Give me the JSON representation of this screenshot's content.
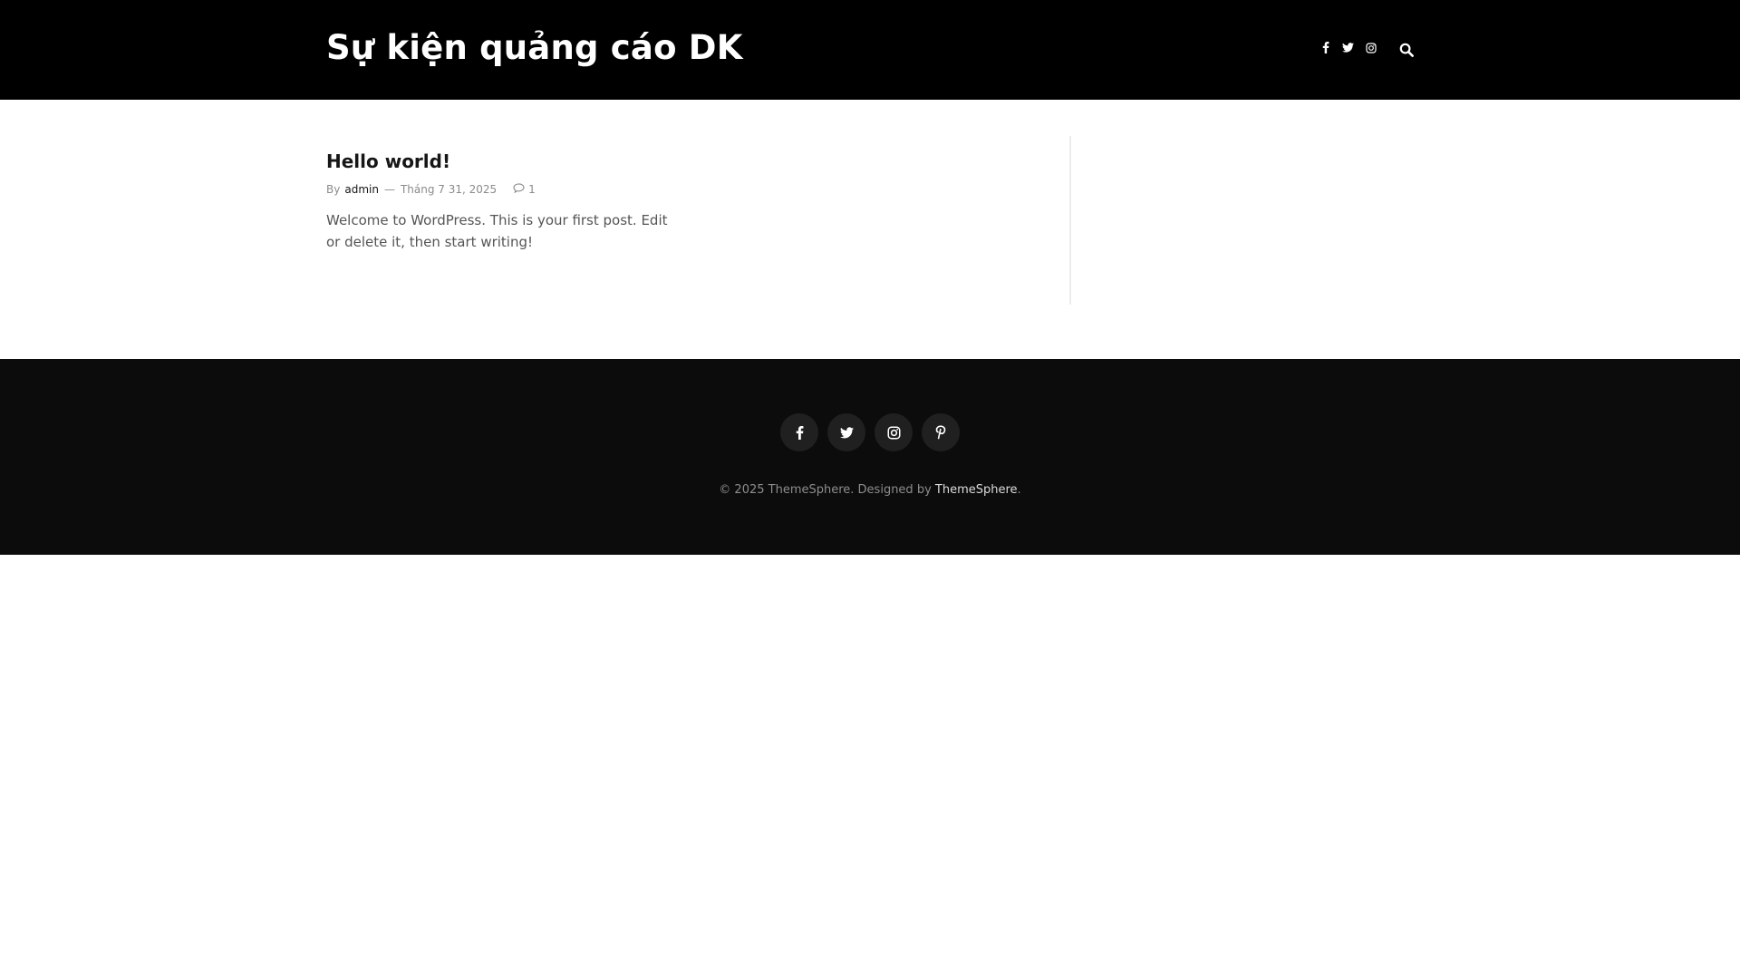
{
  "header": {
    "site_title": "Sự kiện quảng cáo DK",
    "social_icons": [
      "facebook-icon",
      "twitter-icon",
      "instagram-icon"
    ],
    "search_icon": "search-icon"
  },
  "post": {
    "title": "Hello world!",
    "by_label": "By",
    "author": "admin",
    "separator": "—",
    "date": "Tháng 7 31, 2025",
    "comment_count": "1",
    "excerpt": "Welcome to WordPress. This is your first post. Edit or delete it, then start writing!"
  },
  "footer": {
    "social_icons": [
      "facebook-icon",
      "twitter-icon",
      "instagram-icon",
      "pinterest-icon"
    ],
    "copyright_prefix": "© 2025 ThemeSphere. Designed by ",
    "credit_link": "ThemeSphere",
    "copyright_suffix": "."
  },
  "colors": {
    "header_bg": "#000000",
    "footer_bg": "#0c0c0c",
    "footer_icon_bg": "#202020",
    "text_dark": "#161616",
    "text_muted": "#8b8b8b"
  }
}
